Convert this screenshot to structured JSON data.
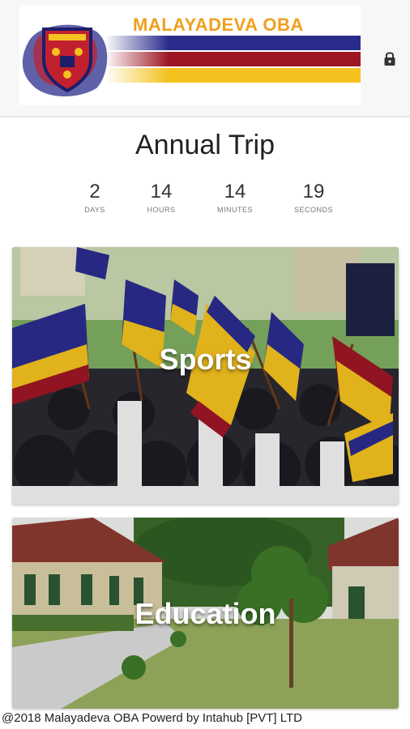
{
  "header": {
    "logo_text": "MALAYADEVA OBA",
    "lock_icon": "lock-icon"
  },
  "page": {
    "title": "Annual Trip"
  },
  "countdown": [
    {
      "value": "2",
      "label": "DAYS"
    },
    {
      "value": "14",
      "label": "HOURS"
    },
    {
      "value": "14",
      "label": "MINUTES"
    },
    {
      "value": "19",
      "label": "SECONDS"
    }
  ],
  "cards": [
    {
      "label": "Sports"
    },
    {
      "label": "Education"
    }
  ],
  "footer": {
    "text": "@2018 Malayadeva OBA Powerd by Intahub [PVT] LTD"
  },
  "colors": {
    "brand_orange": "#f0a01e",
    "brand_blue": "#2a2c8c",
    "brand_red": "#9d1624",
    "brand_yellow": "#f4c21f"
  }
}
